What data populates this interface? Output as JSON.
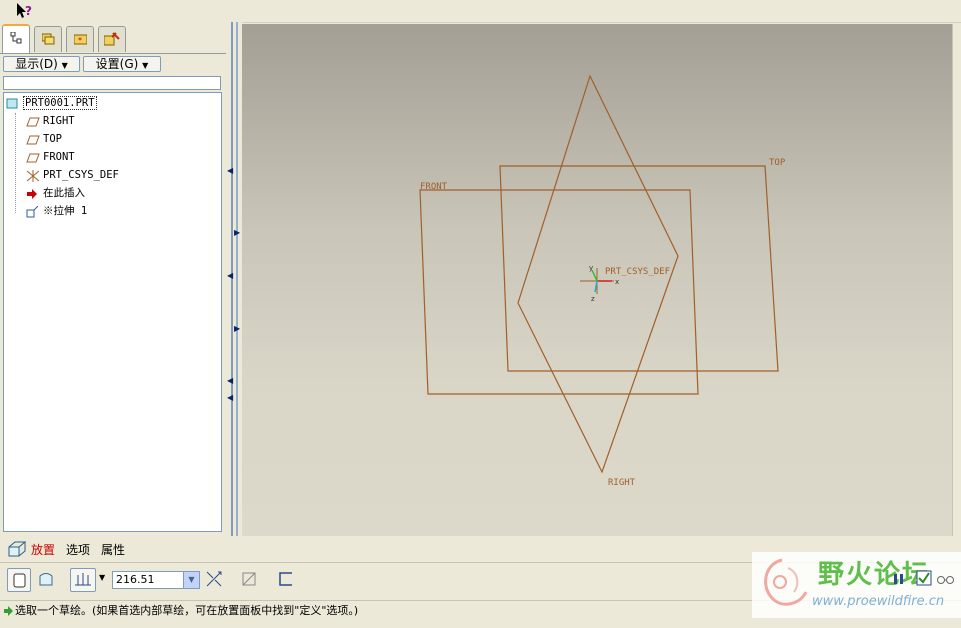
{
  "toolbar": {
    "whats_this_icon": "whats-this-arrow-icon"
  },
  "model_tree_tabs": [
    {
      "name": "model-tree-tab",
      "icon": "tree-icon",
      "active": true
    },
    {
      "name": "folder-browser-tab",
      "icon": "folders-icon",
      "active": false
    },
    {
      "name": "favorites-tab",
      "icon": "favorites-folder-icon",
      "active": false
    },
    {
      "name": "connections-tab",
      "icon": "tools-icon",
      "active": false
    }
  ],
  "tree_controls": {
    "show_label": "显示(D)",
    "settings_label": "设置(G)"
  },
  "tree": {
    "root": "PRT0001.PRT",
    "items": [
      "RIGHT",
      "TOP",
      "FRONT",
      "PRT_CSYS_DEF",
      "在此插入",
      "※拉伸 1"
    ]
  },
  "viewport": {
    "planes": {
      "front": "FRONT",
      "top": "TOP",
      "right": "RIGHT"
    },
    "csys": "PRT_CSYS_DEF",
    "axes": {
      "x": "x",
      "y": "y",
      "z": "z"
    },
    "datum_color": "#a0602a",
    "bg_top": "#a39f95",
    "bg_bottom": "#dcd9cb"
  },
  "dashboard": {
    "tabs": [
      "放置",
      "选项",
      "属性"
    ],
    "active_tab_color": "#cc0000",
    "depth_value": "216.51"
  },
  "status": {
    "message": "选取一个草绘。(如果首选内部草绘，可在放置面板中找到\"定义\"选项。)"
  },
  "watermark": {
    "title": "野火论坛",
    "url": "www.proewildfire.cn"
  }
}
